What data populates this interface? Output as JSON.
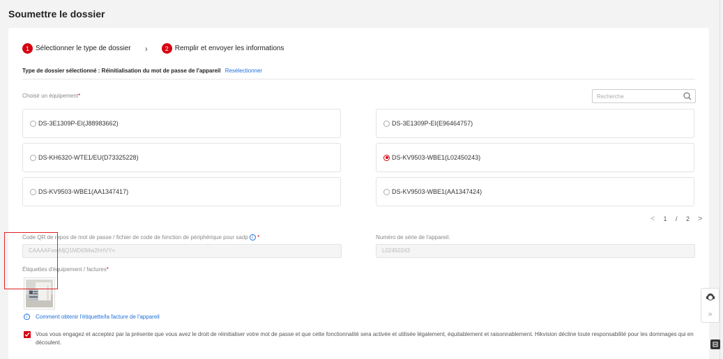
{
  "page": {
    "title": "Soumettre le dossier"
  },
  "steps": [
    {
      "num": "1",
      "label": "Sélectionner le type de dossier"
    },
    {
      "num": "2",
      "label": "Remplir et envoyer les informations"
    }
  ],
  "selection": {
    "text": "Type de dossier sélectionné : Réinitialisation du mot de passe de l'appareil",
    "reselect": "Resélectionner"
  },
  "device_picker": {
    "label": "Choisir un équipement",
    "required": "*",
    "search_placeholder": "Recherche",
    "devices": [
      {
        "name": "DS-3E1309P-EI(J88983662)",
        "selected": false
      },
      {
        "name": "DS-3E1309P-EI(E96464757)",
        "selected": false
      },
      {
        "name": "DS-KH6320-WTE1/EU(D73325228)",
        "selected": false
      },
      {
        "name": "DS-KV9503-WBE1(L02450243)",
        "selected": true
      },
      {
        "name": "DS-KV9503-WBE1(AA1347417)",
        "selected": false
      },
      {
        "name": "DS-KV9503-WBE1(AA1347424)",
        "selected": false
      }
    ],
    "pagination": {
      "prev": "<",
      "current": "1",
      "sep": "/",
      "total": "2",
      "next": ">"
    }
  },
  "qr_field": {
    "label": "Code QR de repos de mot de passe / fichier de code de fonction de périphérique pour sadp",
    "info": "i",
    "required": "*",
    "value": "CAAAAFwwMjQ1MDI0Mw2hHVY="
  },
  "serial_field": {
    "label": "Numéro de série de l'appareil.",
    "value": "L02450243"
  },
  "labels_field": {
    "label": "Étiquettes d'équipement / factures",
    "required": "*",
    "help_link": "Comment obtenir l'étiquette/la facture de l'appareil",
    "info": "i"
  },
  "agreement": {
    "checked": true,
    "text": "Vous vous engagez et acceptez par la présente que vous avez le droit de réinitialiser votre mot de passe et que cette fonctionnalité sera activée et utilisée légalement, équitablement et raisonnablement. Hikvision décline toute responsabilité pour les dommages qui en découlent."
  },
  "side": {
    "collapse": "»"
  },
  "colors": {
    "accent": "#d7000f",
    "link": "#1e6fd9",
    "highlight": "#e02020"
  }
}
